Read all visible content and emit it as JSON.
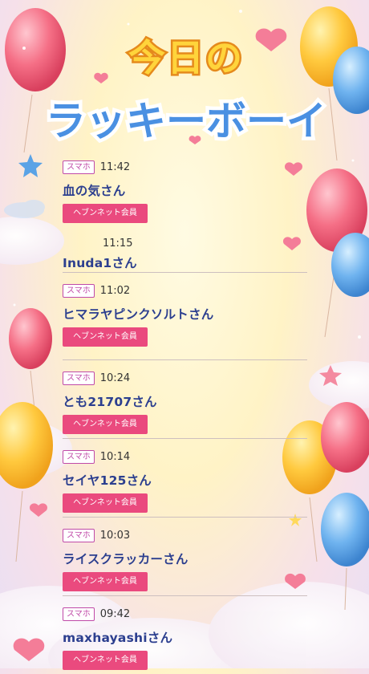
{
  "header": {
    "title_line1": "今日の",
    "title_line2": "ラッキーボーイ"
  },
  "entries": [
    {
      "device": "スマホ",
      "time": "11:42",
      "name": "血の気さん",
      "member": "ヘブンネット会員"
    },
    {
      "device": "",
      "time": "11:15",
      "name": "Inuda1さん",
      "member": ""
    },
    {
      "device": "スマホ",
      "time": "11:02",
      "name": "ヒマラヤピンクソルトさん",
      "member": "ヘブンネット会員"
    },
    {
      "device": "スマホ",
      "time": "10:24",
      "name": "とも21707さん",
      "member": "ヘブンネット会員"
    },
    {
      "device": "スマホ",
      "time": "10:14",
      "name": "セイヤ125さん",
      "member": "ヘブンネット会員"
    },
    {
      "device": "スマホ",
      "time": "10:03",
      "name": "ライスクラッカーさん",
      "member": "ヘブンネット会員"
    },
    {
      "device": "スマホ",
      "time": "09:42",
      "name": "maxhayashiさん",
      "member": "ヘブンネット会員"
    }
  ],
  "colors": {
    "badge": "#c04aa8",
    "member_button": "#ea4a7e",
    "name_text": "#2c3f8f",
    "title_blue": "#3f86dd",
    "title_yellow": "#ffd43b"
  }
}
